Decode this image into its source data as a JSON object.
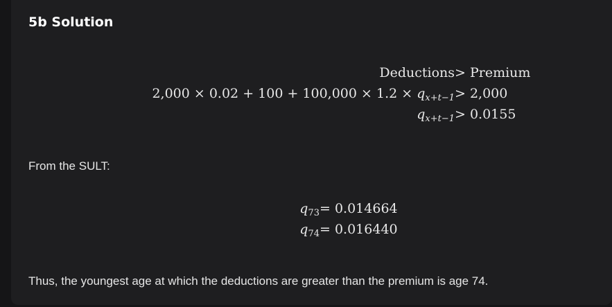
{
  "heading": "5b Solution",
  "equation1": {
    "rows": [
      {
        "lhs": "Deductions",
        "rhs": "> Premium"
      },
      {
        "lhs_parts": [
          "2,000 × 0.02 + 100 + 100,000 × 1.2 × ",
          "q",
          "x+t−1"
        ],
        "rhs": "> 2,000"
      },
      {
        "lhs_parts": [
          "q",
          "x+t−1"
        ],
        "rhs": "> 0.0155"
      }
    ]
  },
  "from_label": "From the SULT:",
  "equation2": {
    "rows": [
      {
        "var": "q",
        "sub": "73",
        "rhs": "= 0.014664"
      },
      {
        "var": "q",
        "sub": "74",
        "rhs": "= 0.016440"
      }
    ]
  },
  "conclusion": "Thus, the youngest age at which the deductions are greater than the premium is age 74."
}
